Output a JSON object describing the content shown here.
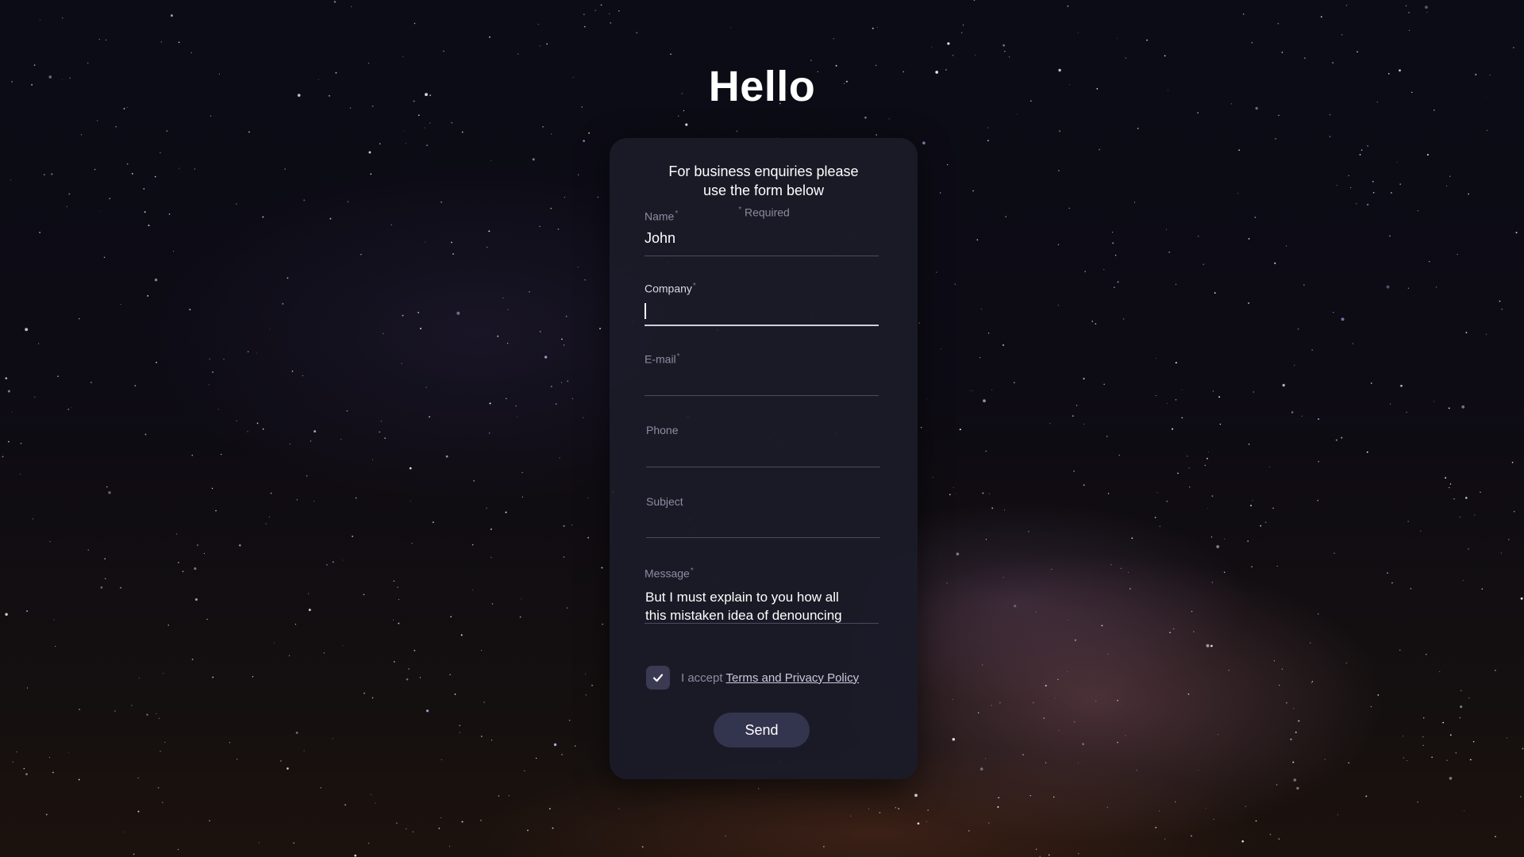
{
  "page": {
    "title": "Hello"
  },
  "form": {
    "intro_line1": "For business enquiries please",
    "intro_line2": "use the form below",
    "required_star": "*",
    "required_note": "Required",
    "fields": {
      "name": {
        "label": "Name",
        "required": true,
        "value": "John"
      },
      "company": {
        "label": "Company",
        "required": true,
        "value": "",
        "focused": true
      },
      "email": {
        "label": "E-mail",
        "required": true,
        "value": ""
      },
      "phone": {
        "label": "Phone",
        "required": false,
        "value": ""
      },
      "subject": {
        "label": "Subject",
        "required": false,
        "value": ""
      },
      "message": {
        "label": "Message",
        "required": true,
        "value_line1": "But I must explain to you how all",
        "value_line2": "this mistaken idea of denouncing"
      }
    },
    "terms": {
      "checked": true,
      "prefix": "I accept",
      "link_text": "Terms and Privacy Policy",
      "check_icon": "checkmark-icon"
    },
    "send_label": "Send"
  },
  "colors": {
    "card_background": "#1b1b28",
    "button_background": "#33344d",
    "checkbox_background": "#3a3a52",
    "label_color": "#8c8ca0",
    "text_color": "#ffffff"
  }
}
